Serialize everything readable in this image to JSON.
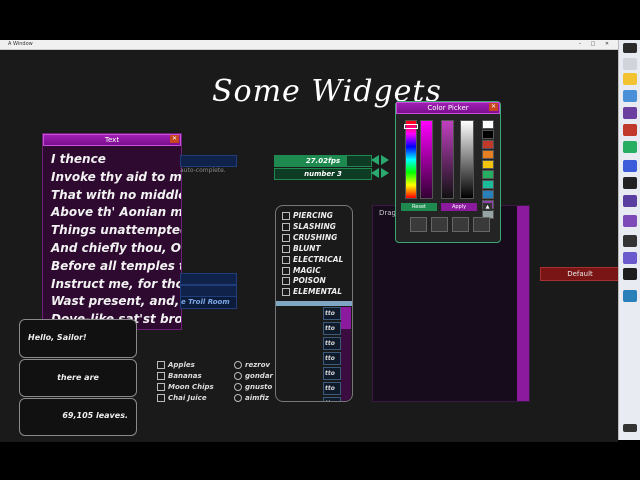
{
  "window": {
    "title": "A Window",
    "minimize_glyph": "–",
    "maximize_glyph": "□",
    "close_glyph": "✕"
  },
  "header": {
    "title": "Some Widgets"
  },
  "text_panel": {
    "title": "Text",
    "close_glyph": "✕",
    "lines": [
      "I thence",
      "Invoke thy aid to my",
      "That with no middle f",
      "Above th' Aonian mou",
      "Things unattempted y",
      "And chiefly thou, O Sp",
      "Before all temples th",
      "Instruct me, for thou",
      "Wast present, and, wi",
      "Dove-like sat'st brood"
    ]
  },
  "autocomplete_hint": "auto-complete.",
  "fps_bar": {
    "label": "27.02fps",
    "fill_fraction": 0.75
  },
  "number_field": {
    "label": "number 3"
  },
  "damage_types": [
    "PIERCING",
    "SLASHING",
    "CRUSHING",
    "BLUNT",
    "ELECTRICAL",
    "MAGIC",
    "POISON",
    "ELEMENTAL"
  ],
  "list_buttons": [
    "tto",
    "tto",
    "tto",
    "tto",
    "tto",
    "tto",
    "tto"
  ],
  "troll_room_label": "e Troll Room",
  "bubbles": [
    "Hello, Sailor!",
    "there are",
    "69,105 leaves."
  ],
  "checkbox_items": [
    "Apples",
    "Bananas",
    "Moon Chips",
    "Chai Juice"
  ],
  "radio_items": [
    "rezrov",
    "gondar",
    "gnusto",
    "aimfiz"
  ],
  "drag_area": {
    "label": "Drag"
  },
  "color_picker": {
    "title": "Color Picker",
    "close_glyph": "✕",
    "reset_label": "Reset",
    "apply_label": "Apply",
    "swatches": [
      "#ffffff",
      "#000000",
      "#c0392b",
      "#e67e22",
      "#f1c40f",
      "#27ae60",
      "#1abc9c",
      "#2980b9",
      "#8e44ad",
      "#95a5a6"
    ],
    "tab_icons": [
      "palette-icon",
      "image-icon",
      "sliders-icon",
      "grid-icon"
    ]
  },
  "dropdown": {
    "selected": "Default"
  },
  "colors": {
    "accent_purple": "#a01eb4",
    "accent_green": "#1e8a50",
    "accent_red": "#8b1a1a",
    "background": "#1a1a1a"
  }
}
